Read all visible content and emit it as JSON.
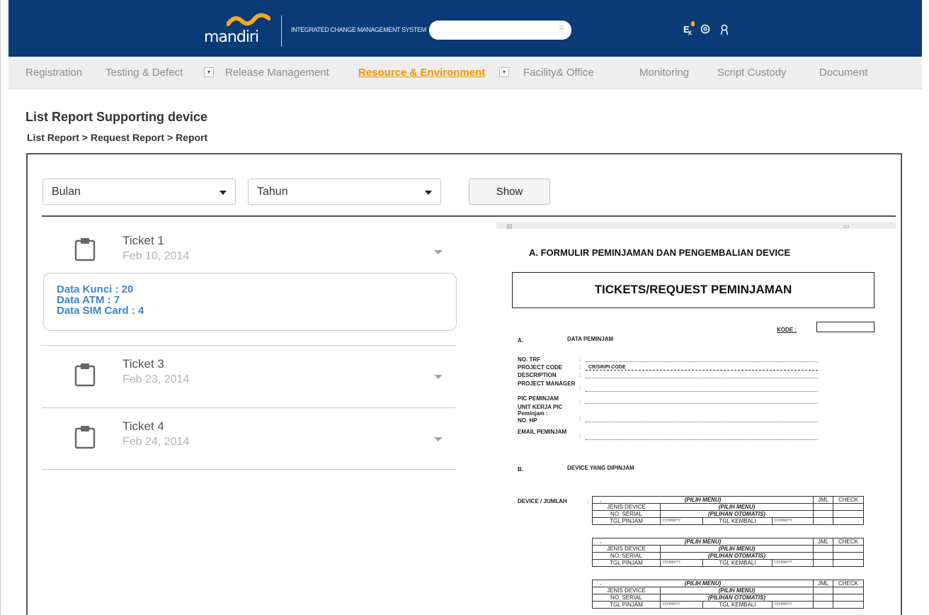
{
  "header": {
    "logo_text": "mandiri",
    "system_title": "INTEGRATED CHANGE MANAGEMENT SYSTEM",
    "search_value": "",
    "icons": [
      "search-icon",
      "excel-export-icon",
      "settings-icon",
      "user-icon"
    ],
    "accent_color": "#0a3b77",
    "logo_wave_color": "#f5a623"
  },
  "menu": {
    "items": [
      {
        "label": "Registration"
      },
      {
        "label": "Testing & Defect"
      },
      {
        "label": "Release  Management"
      },
      {
        "label": "Resource & Environment"
      },
      {
        "label": "Facility& Office"
      },
      {
        "label": "Monitoring"
      },
      {
        "label": "Script Custody"
      },
      {
        "label": "Document"
      }
    ],
    "dropdown_glyph": "▾",
    "active_color": "#f39200"
  },
  "page": {
    "title": "List Report Supporting device",
    "breadcrumb": [
      "List Report",
      "Request Report",
      "Report"
    ],
    "breadcrumb_sep": " > "
  },
  "filters": {
    "month_value": "Bulan",
    "year_value": "Tahun",
    "show_label": "Show"
  },
  "tickets": [
    {
      "title": "Ticket 1",
      "date": "Feb 10, 2014",
      "expanded": true,
      "details": [
        "Data Kunci : 20",
        "Data ATM : 7",
        "Data SIM Card : 4"
      ]
    },
    {
      "title": "Ticket 3",
      "date": "Feb 23, 2014",
      "expanded": false
    },
    {
      "title": "Ticket 4",
      "date": "Feb 24, 2014",
      "expanded": false
    }
  ],
  "document": {
    "heading": "A. FORMULIR PEMINJAMAN DAN PENGEMBALIAN DEVICE",
    "box_title": "TICKETS/REQUEST PEMINJAMAN",
    "kode_label": "KODE :",
    "section_a_letter": "A.",
    "section_a_title": "DATA PEMINJAM",
    "fields": [
      {
        "label": "NO. TRF",
        "value": ""
      },
      {
        "label": "PROJECT CODE",
        "value": "CR/SR/PI CODE"
      },
      {
        "label": "DESCRIPTION",
        "value": ""
      },
      {
        "label": "PROJECT MANAGER",
        "value": ""
      },
      {
        "label": "PIC PEMINJAM",
        "value": ""
      },
      {
        "label": "UNIT KERJA  PIC Peminjam :",
        "value": ""
      },
      {
        "label": "NO. HP",
        "value": ""
      },
      {
        "label": "EMAIL PEMINJAM",
        "value": ""
      }
    ],
    "section_b_letter": "B.",
    "section_b_title": "DEVICE YANG DIPINJAM",
    "device_label": "DEVICE / JUMLAH",
    "colon": ":",
    "dash": "-",
    "table": {
      "menu_choice": "(PILIH MENU)",
      "jml": "JML",
      "check": "CHECK",
      "jenis_device": "JENIS DEVICE",
      "no_serial": "NO. SERIAL",
      "auto_choice": "(PILIHAN OTOMATIS)",
      "tgl_pinjam": "TGL PINJAM",
      "tgl_kembali": "TGL KEMBALI",
      "date_placeholder": "DD/MM/YY"
    }
  }
}
